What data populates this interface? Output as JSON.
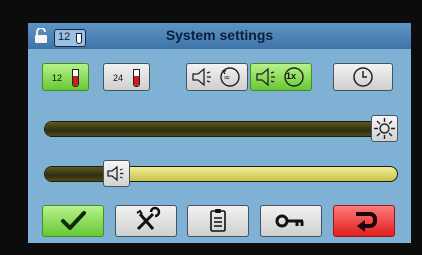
{
  "header": {
    "title": "System settings",
    "tube_indicator": "12",
    "lock_icon": "lock-open-icon"
  },
  "tube_buttons": [
    {
      "label": "12",
      "selected": true
    },
    {
      "label": "24",
      "selected": false
    }
  ],
  "sound_mode_buttons": [
    {
      "icon": "speaker-repeat-icon",
      "selected": false
    },
    {
      "icon": "speaker-repeat-once-icon",
      "badge": "1x",
      "selected": true
    }
  ],
  "clock_button": {
    "icon": "clock-icon"
  },
  "brightness_slider": {
    "icon": "sun-icon",
    "value_percent": 100
  },
  "volume_slider": {
    "icon": "speaker-icon",
    "value_percent": 18
  },
  "bottom_toolbar": [
    {
      "icon": "checkmark-icon",
      "color": "#67c934"
    },
    {
      "icon": "tools-icon"
    },
    {
      "icon": "clipboard-icon"
    },
    {
      "icon": "key-icon"
    },
    {
      "icon": "return-arrow-icon",
      "color": "#e11e1e"
    }
  ]
}
